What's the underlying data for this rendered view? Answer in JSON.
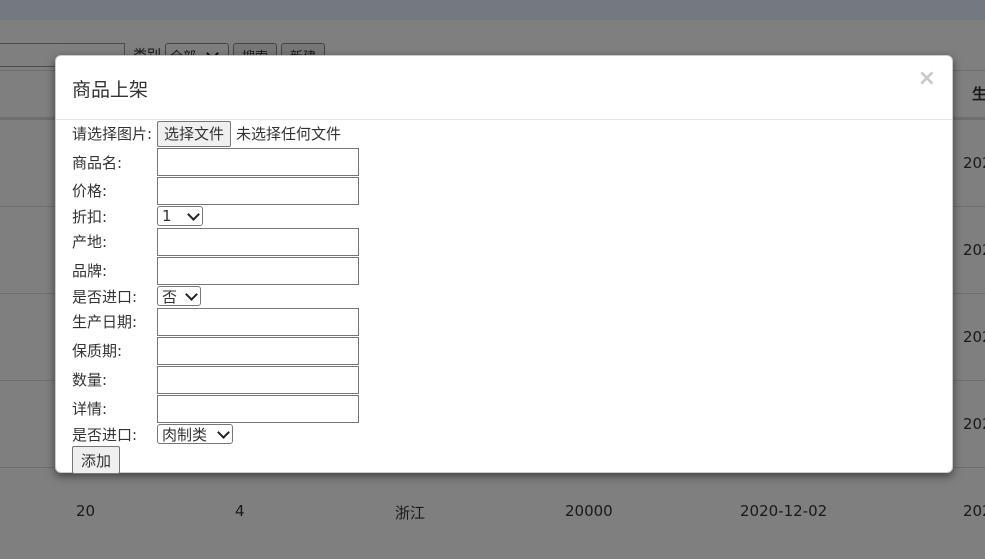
{
  "background": {
    "search": {
      "category_label": "类别",
      "category_value": "全部",
      "search_button": "搜索",
      "new_button": "新建"
    },
    "table": {
      "partial_header": "生",
      "row_edge_values": [
        "202",
        "202",
        "202",
        "202"
      ],
      "last_row": [
        "20",
        "4",
        "浙江",
        "20000",
        "2020-12-02",
        "202"
      ]
    }
  },
  "modal": {
    "title": "商品上架",
    "close": "×",
    "fields": {
      "image_label": "请选择图片:",
      "file_button": "选择文件",
      "file_status": "未选择任何文件",
      "name_label": "商品名:",
      "price_label": "价格:",
      "discount_label": "折扣:",
      "discount_value": "1",
      "origin_label": "产地:",
      "brand_label": "品牌:",
      "import_label": "是否进口:",
      "import_value": "否",
      "production_date_label": "生产日期:",
      "shelf_life_label": "保质期:",
      "quantity_label": "数量:",
      "details_label": "详情:",
      "category_label": "是否进口:",
      "category_value": "肉制类"
    },
    "add_button": "添加"
  }
}
